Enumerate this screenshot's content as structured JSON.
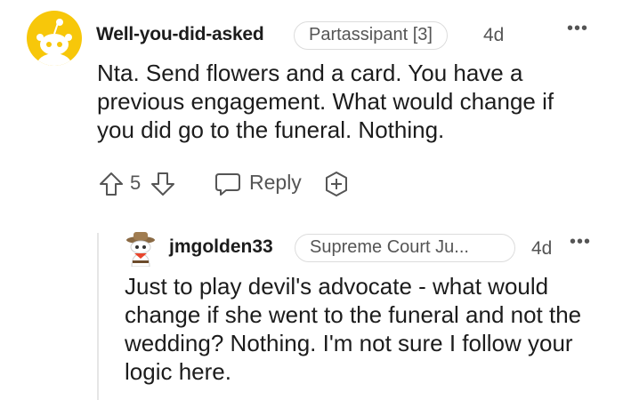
{
  "comment": {
    "username": "Well-you-did-asked",
    "flair": "Partassipant [3]",
    "timestamp": "4d",
    "more_label": "•••",
    "body": "Nta. Send flowers and a card. You have a previous engagement. What would change if you did go to the funeral. Nothing.",
    "vote_count": "5",
    "reply_label": "Reply",
    "avatar_color": "#f7c70a"
  },
  "reply": {
    "username": "jmgolden33",
    "flair": "Supreme Court Ju...",
    "timestamp": "4d",
    "more_label": "•••",
    "body": "Just to play devil's advocate - what would change if she went to the funeral and not the wedding? Nothing. I'm not sure I follow your logic here."
  },
  "icons": {
    "upvote": "upvote-icon",
    "downvote": "downvote-icon",
    "reply": "comment-bubble-icon",
    "award": "award-plus-icon",
    "more": "more-options-icon"
  },
  "colors": {
    "text": "#1c1c1c",
    "meta": "#555555",
    "border": "#dcdcdc",
    "thread_line": "#e6e6e6"
  }
}
